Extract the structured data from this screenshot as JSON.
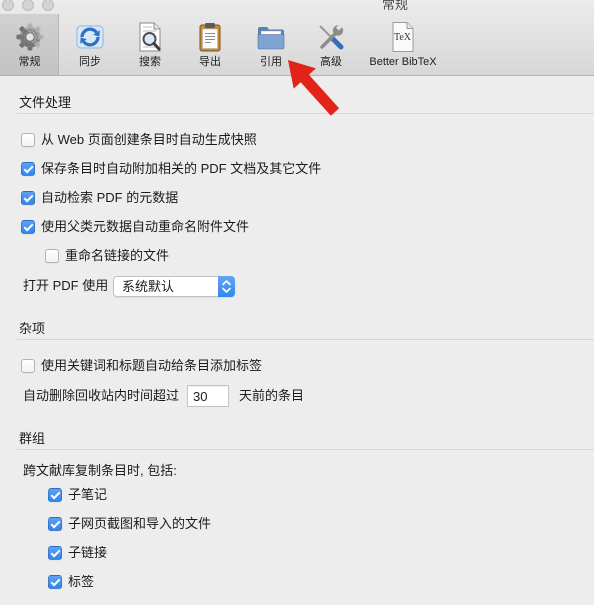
{
  "window": {
    "title": "常规"
  },
  "colors": {
    "accent": "#3186f0",
    "annotation_arrow": "#e2231a"
  },
  "toolbar": {
    "items": [
      {
        "label": "常规",
        "icon": "gear-icon",
        "selected": true
      },
      {
        "label": "同步",
        "icon": "sync-icon",
        "selected": false
      },
      {
        "label": "搜索",
        "icon": "search-document-icon",
        "selected": false
      },
      {
        "label": "导出",
        "icon": "clipboard-icon",
        "selected": false
      },
      {
        "label": "引用",
        "icon": "folder-icon",
        "selected": false
      },
      {
        "label": "高级",
        "icon": "tools-icon",
        "selected": false
      },
      {
        "label": "Better BibTeX",
        "icon": "tex-document-icon",
        "icon_text": "TeX",
        "selected": false
      }
    ]
  },
  "file_handling": {
    "title": "文件处理",
    "options": [
      {
        "label": "从 Web 页面创建条目时自动生成快照",
        "checked": false
      },
      {
        "label": "保存条目时自动附加相关的 PDF 文档及其它文件",
        "checked": true
      },
      {
        "label": "自动检索 PDF 的元数据",
        "checked": true
      },
      {
        "label": "使用父类元数据自动重命名附件文件",
        "checked": true
      },
      {
        "label": "重命名链接的文件",
        "checked": false
      }
    ],
    "open_pdf_label": "打开 PDF 使用",
    "open_pdf_value": "系统默认"
  },
  "misc": {
    "title": "杂项",
    "options": [
      {
        "label": "使用关键词和标题自动给条目添加标签",
        "checked": false
      }
    ],
    "trash_prefix": "自动删除回收站内时间超过",
    "trash_days": "30",
    "trash_suffix": "天前的条目"
  },
  "groups": {
    "title": "群组",
    "intro": "跨文献库复制条目时, 包括:",
    "options": [
      {
        "label": "子笔记",
        "checked": true
      },
      {
        "label": "子网页截图和导入的文件",
        "checked": true
      },
      {
        "label": "子链接",
        "checked": true
      },
      {
        "label": "标签",
        "checked": true
      }
    ]
  }
}
